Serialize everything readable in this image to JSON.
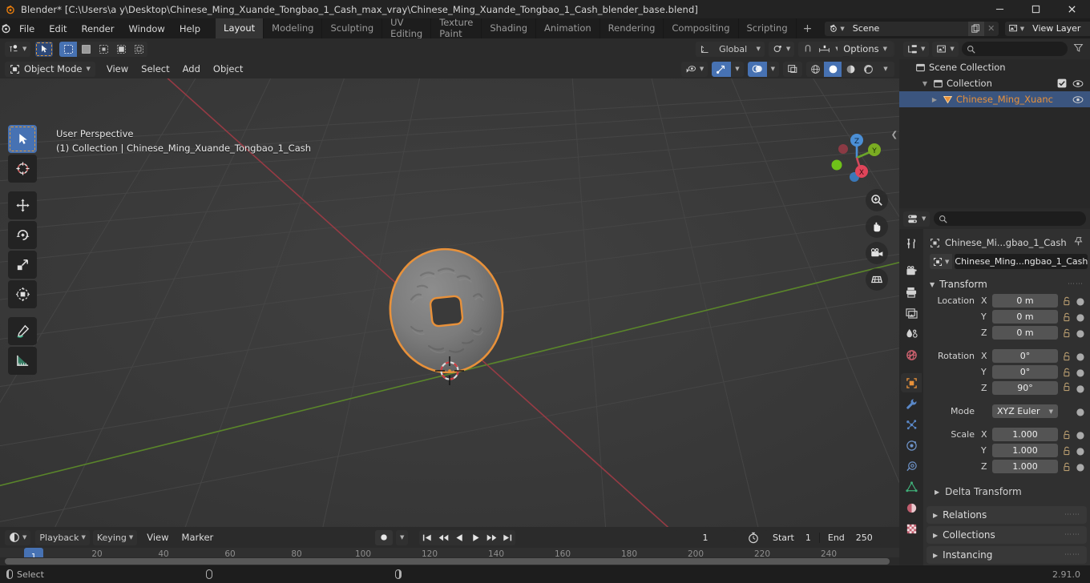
{
  "titlebar": {
    "title": "Blender* [C:\\Users\\a y\\Desktop\\Chinese_Ming_Xuande_Tongbao_1_Cash_max_vray\\Chinese_Ming_Xuande_Tongbao_1_Cash_blender_base.blend]",
    "minimize": "—",
    "maximize": "❐",
    "close": "✕"
  },
  "topbar": {
    "menus": [
      "File",
      "Edit",
      "Render",
      "Window",
      "Help"
    ],
    "workspaces": [
      {
        "label": "Layout",
        "active": true
      },
      {
        "label": "Modeling",
        "active": false
      },
      {
        "label": "Sculpting",
        "active": false
      },
      {
        "label": "UV Editing",
        "active": false
      },
      {
        "label": "Texture Paint",
        "active": false
      },
      {
        "label": "Shading",
        "active": false
      },
      {
        "label": "Animation",
        "active": false
      },
      {
        "label": "Rendering",
        "active": false
      },
      {
        "label": "Compositing",
        "active": false
      },
      {
        "label": "Scripting",
        "active": false
      }
    ],
    "add_workspace": "+",
    "scene_name": "Scene",
    "view_layer_name": "View Layer"
  },
  "viewport": {
    "mode": "Object Mode",
    "menus": [
      "View",
      "Select",
      "Add",
      "Object"
    ],
    "transform_orientation": "Global",
    "options_label": "Options",
    "overlay_line1": "User Perspective",
    "overlay_line2": "(1) Collection | Chinese_Ming_Xuande_Tongbao_1_Cash",
    "gizmo_axes": {
      "x": "X",
      "y": "Y",
      "z": "Z"
    },
    "tools": [
      "select-box-tool",
      "cursor-tool",
      "move-tool",
      "rotate-tool",
      "scale-tool",
      "transform-tool",
      "annotate-tool",
      "measure-tool"
    ],
    "nav_buttons": [
      "zoom-icon",
      "pan-hand-icon",
      "camera-view-icon",
      "ortho-persp-icon"
    ]
  },
  "timeline": {
    "playback_label": "Playback",
    "keying_label": "Keying",
    "view_label": "View",
    "marker_label": "Marker",
    "current_frame": "1",
    "start_label": "Start",
    "start_value": "1",
    "end_label": "End",
    "end_value": "250",
    "playhead_frame": "1",
    "ruler_ticks": [
      "20",
      "40",
      "60",
      "80",
      "100",
      "120",
      "140",
      "160",
      "180",
      "200",
      "220",
      "240"
    ],
    "transport": [
      "jump-start-icon",
      "prev-keyframe-icon",
      "play-reverse-icon",
      "play-icon",
      "next-keyframe-icon",
      "jump-end-icon"
    ]
  },
  "outliner": {
    "search_placeholder": "",
    "rows": [
      {
        "label": "Scene Collection",
        "depth": 0,
        "icon": "collection-icon",
        "selected": false,
        "has_disclosure": false,
        "checkbox": false,
        "eye": false
      },
      {
        "label": "Collection",
        "depth": 1,
        "icon": "collection-icon",
        "selected": false,
        "has_disclosure": true,
        "checkbox": true,
        "eye": true
      },
      {
        "label": "Chinese_Ming_Xuanc",
        "depth": 2,
        "icon": "mesh-object-icon",
        "selected": true,
        "has_disclosure": true,
        "checkbox": false,
        "eye": true
      }
    ]
  },
  "properties": {
    "search_placeholder": "",
    "breadcrumb": "Chinese_Mi...gbao_1_Cash",
    "object_name": "Chinese_Ming...ngbao_1_Cash",
    "tabs": [
      "tool-icon",
      "render-icon",
      "output-icon",
      "view-layer-icon",
      "scene-icon",
      "world-icon",
      "object-icon",
      "modifier-icon",
      "particles-icon",
      "physics-icon",
      "constraints-icon",
      "object-data-icon",
      "material-icon",
      "texture-icon"
    ],
    "active_tab_index": 6,
    "transform_title": "Transform",
    "location": {
      "label": "Location",
      "axes": [
        "X",
        "Y",
        "Z"
      ],
      "values": [
        "0 m",
        "0 m",
        "0 m"
      ]
    },
    "rotation": {
      "label": "Rotation",
      "axes": [
        "X",
        "Y",
        "Z"
      ],
      "values": [
        "0°",
        "0°",
        "90°"
      ]
    },
    "mode": {
      "label": "Mode",
      "value": "XYZ Euler"
    },
    "scale": {
      "label": "Scale",
      "axes": [
        "X",
        "Y",
        "Z"
      ],
      "values": [
        "1.000",
        "1.000",
        "1.000"
      ]
    },
    "delta_transform": "Delta Transform",
    "panels": [
      "Relations",
      "Collections",
      "Instancing"
    ]
  },
  "statusbar": {
    "select_label": "Select",
    "version": "2.91.0"
  },
  "colors": {
    "accent_blue": "#4772b3",
    "selection_orange": "#e8913a",
    "header_bg": "#2b2b2b",
    "viewport_bg": "#3b3b3b",
    "panel_bg": "#303030"
  }
}
